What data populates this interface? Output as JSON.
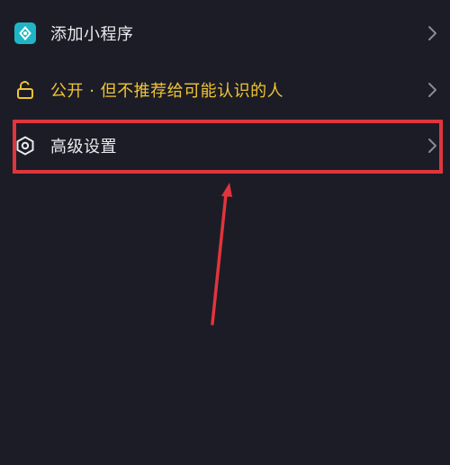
{
  "menu": {
    "items": [
      {
        "label": "添加小程序",
        "icon": "mini-program-icon"
      },
      {
        "label": "公开 · 但不推荐给可能认识的人",
        "icon": "unlock-icon",
        "color": "#f0c435"
      },
      {
        "label": "高级设置",
        "icon": "hexagon-settings-icon"
      }
    ]
  },
  "annotation": {
    "highlight_color": "#e0353c",
    "arrow_color": "#e0353c"
  }
}
